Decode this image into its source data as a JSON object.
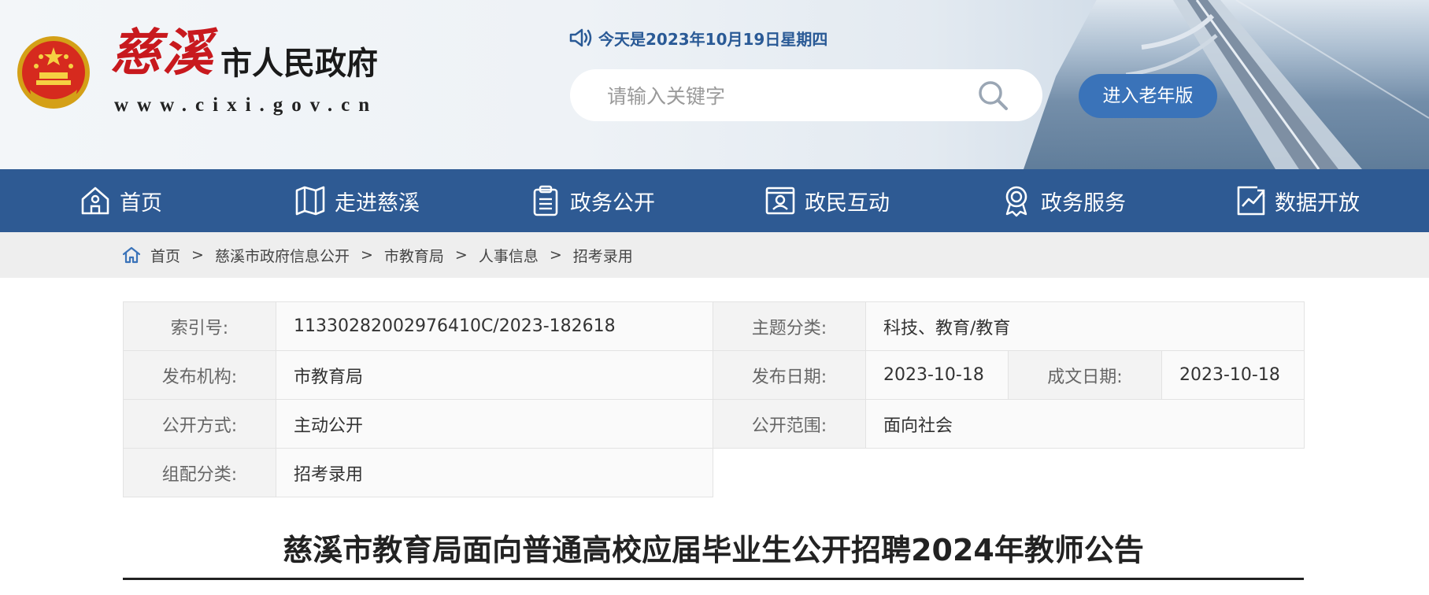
{
  "header": {
    "logo_name": "慈溪",
    "logo_suffix": "市人民政府",
    "logo_url": "www.cixi.gov.cn",
    "date_text": "今天是2023年10月19日星期四",
    "search_placeholder": "请输入关键字",
    "elder_mode_label": "进入老年版"
  },
  "nav": {
    "items": [
      {
        "label": "首页",
        "icon": "home-icon"
      },
      {
        "label": "走进慈溪",
        "icon": "map-icon"
      },
      {
        "label": "政务公开",
        "icon": "clipboard-icon"
      },
      {
        "label": "政民互动",
        "icon": "user-card-icon"
      },
      {
        "label": "政务服务",
        "icon": "badge-icon"
      },
      {
        "label": "数据开放",
        "icon": "chart-icon"
      }
    ]
  },
  "breadcrumb": [
    "首页",
    "慈溪市政府信息公开",
    "市教育局",
    "人事信息",
    "招考录用"
  ],
  "info": {
    "index_label": "索引号:",
    "index_value": "11330282002976410C/2023-182618",
    "topic_label": "主题分类:",
    "topic_value": "科技、教育/教育",
    "org_label": "发布机构:",
    "org_value": "市教育局",
    "pubdate_label": "发布日期:",
    "pubdate_value": "2023-10-18",
    "docdate_label": "成文日期:",
    "docdate_value": "2023-10-18",
    "method_label": "公开方式:",
    "method_value": "主动公开",
    "scope_label": "公开范围:",
    "scope_value": "面向社会",
    "category_label": "组配分类:",
    "category_value": "招考录用"
  },
  "article": {
    "title": "慈溪市教育局面向普通高校应届毕业生公开招聘2024年教师公告"
  },
  "colors": {
    "nav_bg": "#2e5a93",
    "accent_blue": "#3a73b9",
    "logo_red": "#c8191e",
    "date_blue": "#2a5a96"
  }
}
